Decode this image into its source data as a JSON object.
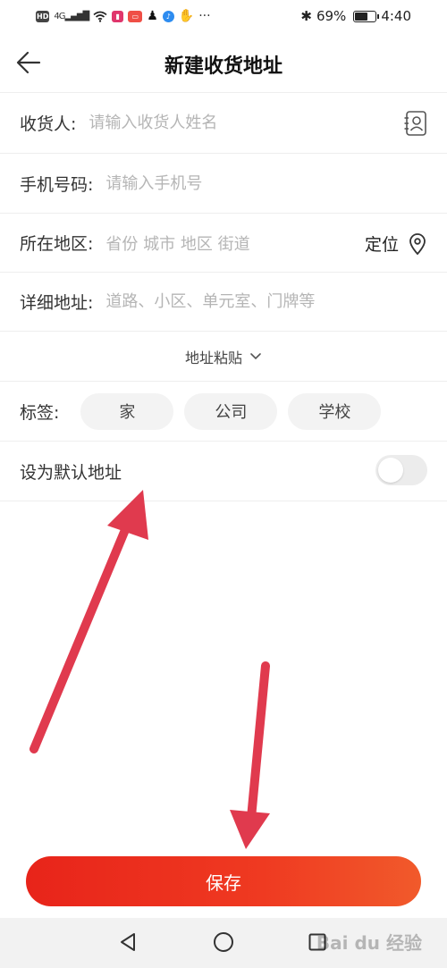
{
  "status_bar": {
    "hd": "HD",
    "signal": "4G",
    "more": "···",
    "battery_percent": "69%",
    "battery_level": 0.69,
    "time": "4:40"
  },
  "header": {
    "title": "新建收货地址"
  },
  "form": {
    "recipient": {
      "label": "收货人:",
      "placeholder": "请输入收货人姓名"
    },
    "phone": {
      "label": "手机号码:",
      "placeholder": "请输入手机号"
    },
    "region": {
      "label": "所在地区:",
      "placeholder": "省份 城市 地区 街道",
      "locate_label": "定位"
    },
    "detail": {
      "label": "详细地址:",
      "placeholder": "道路、小区、单元室、门牌等"
    },
    "paste": {
      "label": "地址粘贴"
    },
    "tags": {
      "label": "标签:",
      "options": [
        "家",
        "公司",
        "学校"
      ]
    },
    "default_address": {
      "label": "设为默认地址",
      "enabled": false
    }
  },
  "save_button": {
    "label": "保存"
  },
  "watermark": "Bai du 经验",
  "colors": {
    "accent": "#e8241a",
    "annotation_arrow": "#e03a4e",
    "placeholder": "#b5b5b5"
  }
}
